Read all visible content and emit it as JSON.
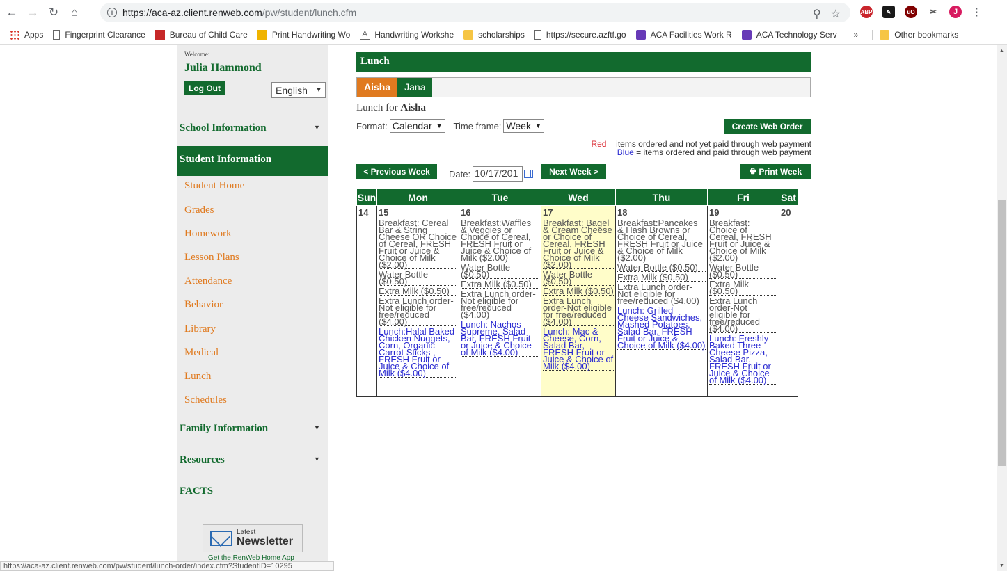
{
  "browser": {
    "url_host": "https://aca-az.client.renweb.com",
    "url_path": "/pw/student/lunch.cfm",
    "profile_initial": "J",
    "bookmarks": [
      {
        "label": "Apps"
      },
      {
        "label": "Fingerprint Clearance"
      },
      {
        "label": "Bureau of Child Care"
      },
      {
        "label": "Print Handwriting Wo"
      },
      {
        "label": "Handwriting Workshe"
      },
      {
        "label": "scholarships"
      },
      {
        "label": "https://secure.azftf.go"
      },
      {
        "label": "ACA Facilities Work R"
      },
      {
        "label": "ACA Technology Serv"
      }
    ],
    "more_bookmarks": "»",
    "other_bookmarks": "Other bookmarks",
    "status_url": "https://aca-az.client.renweb.com/pw/student/lunch-order/index.cfm?StudentID=10295"
  },
  "sidebar": {
    "welcome": "Welcome:",
    "user_name": "Julia Hammond",
    "logout": "Log Out",
    "language": "English",
    "school_info": "School Information",
    "student_info": "Student Information",
    "student_items": [
      "Student Home",
      "Grades",
      "Homework",
      "Lesson Plans",
      "Attendance",
      "Behavior",
      "Library",
      "Medical",
      "Lunch",
      "Schedules"
    ],
    "family_info": "Family Information",
    "resources": "Resources",
    "facts": "FACTS",
    "newsletter_top": "Latest",
    "newsletter_bottom": "Newsletter",
    "get_app": "Get the RenWeb Home App"
  },
  "main": {
    "title": "Lunch",
    "tabs": [
      "Aisha",
      "Jana"
    ],
    "lunch_for_prefix": "Lunch for",
    "student": "Aisha",
    "format_label": "Format:",
    "format_value": "Calendar",
    "timeframe_label": "Time frame:",
    "timeframe_value": "Week",
    "create_order": "Create Web Order",
    "legend_red_word": "Red",
    "legend_red_text": " = items ordered and not yet paid through web payment",
    "legend_blue_word": "Blue",
    "legend_blue_text": " = items ordered and paid through web payment",
    "prev_week": "< Previous Week",
    "date_label": "Date:",
    "date_value": "10/17/201",
    "next_week": "Next Week >",
    "print_week": "Print Week",
    "colors": {
      "green": "#126a2e",
      "orange": "#e07a1f",
      "red": "#d9262f",
      "blue": "#2a2ad1",
      "today": "#fffdc9"
    }
  },
  "calendar": {
    "headers": [
      "Sun",
      "Mon",
      "Tue",
      "Wed",
      "Thu",
      "Fri",
      "Sat"
    ],
    "days": [
      {
        "num": "14",
        "entries": []
      },
      {
        "num": "15",
        "entries": [
          {
            "text": "Breakfast: Cereal Bar & String Cheese OR Choice of Cereal, FRESH Fruit or Juice & Choice of Milk ($2.00)",
            "paid": false
          },
          {
            "text": "Water Bottle ($0.50)",
            "paid": false
          },
          {
            "text": "Extra Milk ($0.50)",
            "paid": false
          },
          {
            "text": "Extra Lunch order-Not eligible for free/reduced ($4.00)",
            "paid": false
          },
          {
            "text": "Lunch:Halal Baked Chicken Nuggets, Corn, Organic Carrot Sticks , FRESH Fruit or Juice & Choice of Milk ($4.00)",
            "paid": true
          }
        ]
      },
      {
        "num": "16",
        "entries": [
          {
            "text": "Breakfast:Waffles & Veggies or Choice of Cereal, FRESH Fruit or Juice & Choice of Milk ($2.00)",
            "paid": false
          },
          {
            "text": "Water Bottle ($0.50)",
            "paid": false
          },
          {
            "text": "Extra Milk ($0.50)",
            "paid": false
          },
          {
            "text": "Extra Lunch order-Not eligible for free/reduced ($4.00)",
            "paid": false
          },
          {
            "text": "Lunch: Nachos Supreme, Salad Bar, FRESH Fruit or Juice & Choice of Milk ($4.00)",
            "paid": true
          }
        ]
      },
      {
        "num": "17",
        "today": true,
        "entries": [
          {
            "text": "Breakfast: Bagel & Cream Cheese or Choice of Cereal, FRESH Fruit or Juice & Choice of Milk ($2.00)",
            "paid": false
          },
          {
            "text": "Water Bottle ($0.50)",
            "paid": false
          },
          {
            "text": "Extra Milk ($0.50)",
            "paid": false
          },
          {
            "text": "Extra Lunch order-Not eligible for free/reduced ($4.00)",
            "paid": false
          },
          {
            "text": "Lunch: Mac & Cheese, Corn, Salad Bar, FRESH Fruit or Juice & Choice of Milk ($4.00)",
            "paid": true
          }
        ]
      },
      {
        "num": "18",
        "entries": [
          {
            "text": "Breakfast:Pancakes & Hash Browns or Choice of Cereal, FRESH Fruit or Juice & Choice of Milk ($2.00)",
            "paid": false
          },
          {
            "text": "Water Bottle ($0.50)",
            "paid": false
          },
          {
            "text": "Extra Milk ($0.50)",
            "paid": false
          },
          {
            "text": "Extra Lunch order-Not eligible for free/reduced ($4.00)",
            "paid": false
          },
          {
            "text": "Lunch: Grilled Cheese Sandwiches, Mashed Potatoes, Salad Bar, FRESH Fruit or Juice & Choice of Milk ($4.00)",
            "paid": true
          }
        ]
      },
      {
        "num": "19",
        "entries": [
          {
            "text": "Breakfast: Choice of Cereal, FRESH Fruit or Juice & Choice of Milk ($2.00)",
            "paid": false
          },
          {
            "text": "Water Bottle ($0.50)",
            "paid": false
          },
          {
            "text": "Extra Milk ($0.50)",
            "paid": false
          },
          {
            "text": "Extra Lunch order-Not eligible for free/reduced ($4.00)",
            "paid": false
          },
          {
            "text": "Lunch: Freshly Baked Three Cheese Pizza, Salad Bar, FRESH Fruit or Juice & Choice of Milk ($4.00)",
            "paid": true
          }
        ]
      },
      {
        "num": "20",
        "entries": []
      }
    ]
  }
}
